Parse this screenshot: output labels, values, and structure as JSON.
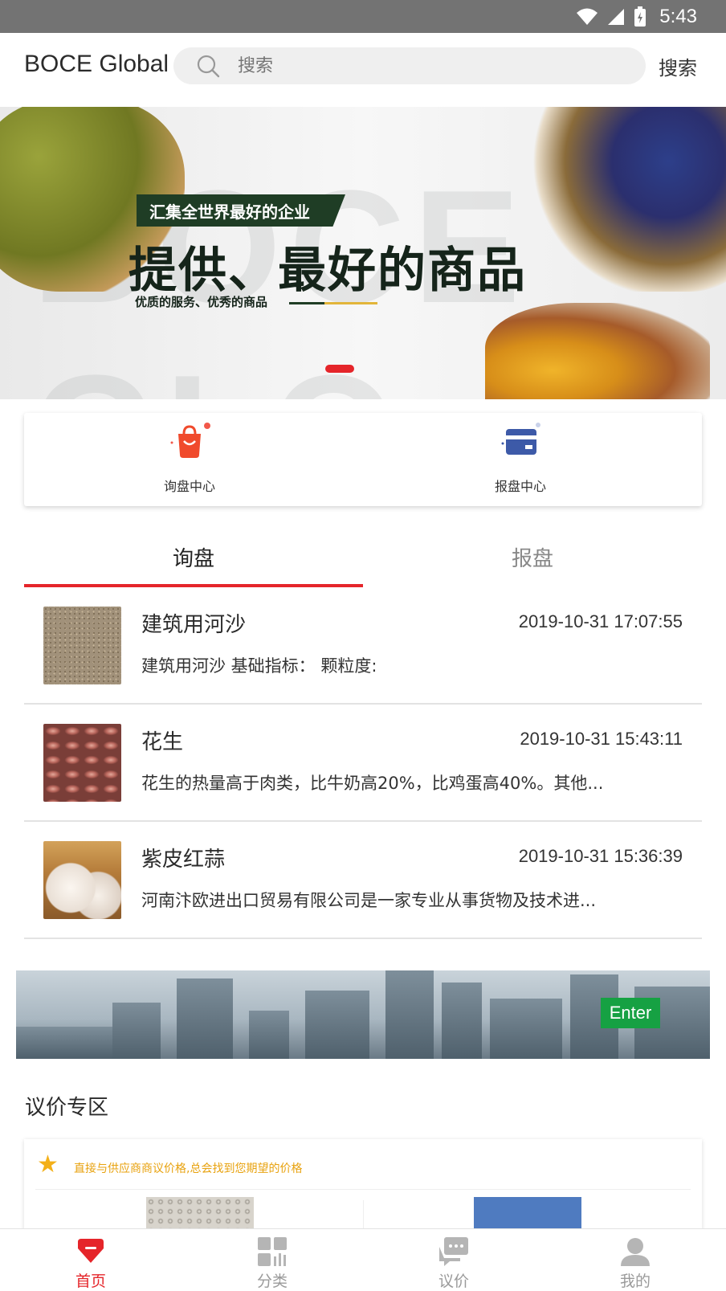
{
  "status_bar": {
    "time": "5:43"
  },
  "header": {
    "brand": "BOCE Global",
    "search_placeholder": "搜索",
    "search_button": "搜索"
  },
  "banner": {
    "watermark": "BOCE GLO",
    "tag": "汇集全世界最好的企业",
    "headline": "提供、最好的商品",
    "subline": "优质的服务、优秀的商品"
  },
  "quick_entries": [
    {
      "label": "询盘中心",
      "icon": "shopping-bag-icon"
    },
    {
      "label": "报盘中心",
      "icon": "card-icon"
    }
  ],
  "tabs": [
    {
      "label": "询盘",
      "active": true
    },
    {
      "label": "报盘",
      "active": false
    }
  ],
  "inquiries": [
    {
      "title": "建筑用河沙",
      "time": "2019-10-31 17:07:55",
      "desc": "建筑用河沙 基础指标： 颗粒度:"
    },
    {
      "title": "花生",
      "time": "2019-10-31 15:43:11",
      "desc": "花生的热量高于肉类，比牛奶高20%，比鸡蛋高40%。其他..."
    },
    {
      "title": "紫皮红蒜",
      "time": "2019-10-31 15:36:39",
      "desc": "河南汴欧进出口贸易有限公司是一家专业从事货物及技术进..."
    }
  ],
  "city_banner": {
    "enter_label": "Enter"
  },
  "bargain": {
    "section_title": "议价专区",
    "tip": "直接与供应商商议价格,总会找到您期望的价格"
  },
  "bottom_nav": [
    {
      "label": "首页",
      "icon": "home-icon",
      "active": true
    },
    {
      "label": "分类",
      "icon": "category-icon",
      "active": false
    },
    {
      "label": "议价",
      "icon": "chat-icon",
      "active": false
    },
    {
      "label": "我的",
      "icon": "user-icon",
      "active": false
    }
  ],
  "colors": {
    "accent": "#e5252a",
    "enter": "#16a143",
    "tip": "#e8a20e"
  }
}
